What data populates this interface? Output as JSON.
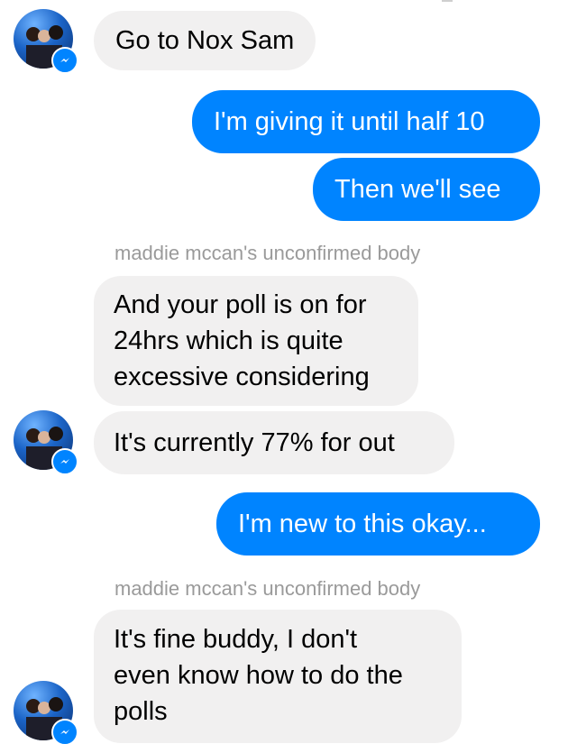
{
  "colors": {
    "incoming_bg": "#f1f0f0",
    "outgoing_bg": "#0084ff",
    "sender_label": "#9a9a9a",
    "badge": "#0084ff"
  },
  "messages": [
    {
      "direction": "incoming",
      "lines": [
        "Go to Nox Sam"
      ]
    },
    {
      "direction": "outgoing",
      "lines": [
        "I'm giving it until half 10"
      ]
    },
    {
      "direction": "outgoing",
      "lines": [
        "Then we'll see"
      ]
    },
    {
      "direction": "sender-label",
      "text": "maddie mccan's unconfirmed body"
    },
    {
      "direction": "incoming",
      "lines": [
        "And your poll is on for",
        "24hrs which is quite",
        "excessive considering"
      ]
    },
    {
      "direction": "incoming",
      "lines": [
        "It's currently 77% for out"
      ]
    },
    {
      "direction": "outgoing",
      "lines": [
        "I'm new to this okay..."
      ]
    },
    {
      "direction": "sender-label",
      "text": "maddie mccan's unconfirmed body"
    },
    {
      "direction": "incoming",
      "lines": [
        "It's fine buddy, I don't",
        "even know how to do the",
        "polls"
      ]
    }
  ],
  "icons": {
    "avatar": "group-photo-avatar",
    "badge": "messenger-bolt-icon"
  }
}
